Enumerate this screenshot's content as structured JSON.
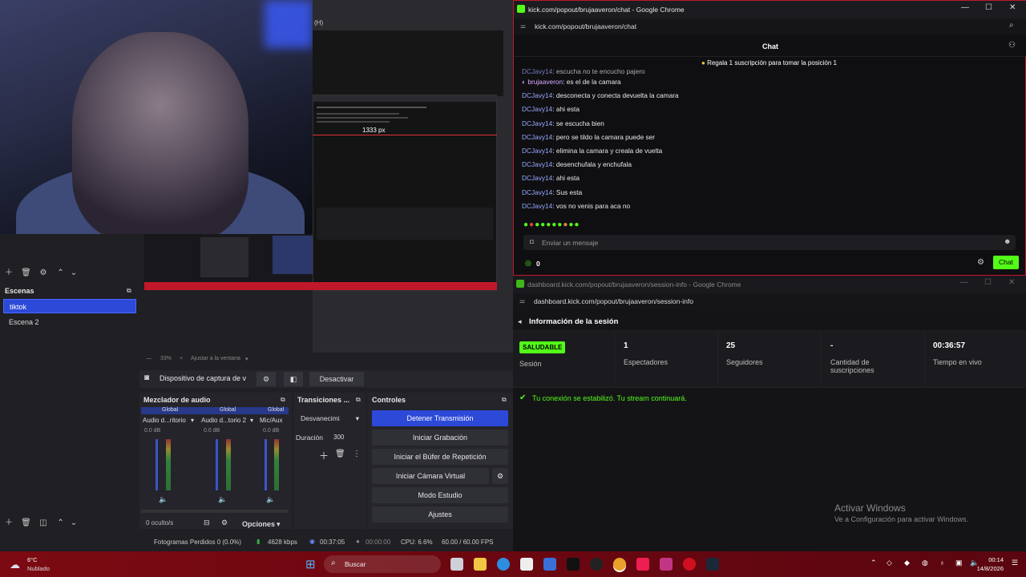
{
  "obs": {
    "preview_px_label": "1333 px",
    "preview_zoom": "33%",
    "preview_fit": "Ajustar a la ventana",
    "source_label": "Dispositivo de captura de v",
    "deactivate_label": "Desactivar",
    "scenes_title": "Escenas",
    "scenes": [
      "tiktok",
      "Escena 2"
    ],
    "mixer_title": "Mezclador de audio",
    "mixer_channels": [
      {
        "group": "Global",
        "name": "Audio d...ritorio",
        "db": "0.0 dB"
      },
      {
        "group": "Global",
        "name": "Audio d...torio 2",
        "db": "0.0 dB"
      },
      {
        "group": "Global",
        "name": "Mic/Aux",
        "db": "0.0 dB"
      }
    ],
    "mixer_hidden": "0 oculto/s",
    "transitions_title": "Transiciones ...",
    "transition_type": "Desvanecimi",
    "duration_label": "Duración",
    "duration_value": "300",
    "controls_title": "Controles",
    "controls": {
      "stop_stream": "Detener Transmisión",
      "start_rec": "Iniciar Grabación",
      "replay_buffer": "Iniciar el Búfer de Repetición",
      "virtual_cam": "Iniciar Cámara Virtual",
      "studio_mode": "Modo Estudio",
      "settings": "Ajustes"
    },
    "options_label": "Opciones",
    "status": {
      "dropped": "Fotogramas Perdidos 0 (0.0%)",
      "kbps": "4628 kbps",
      "live_time": "00:37:05",
      "rec_time": "00:00:00",
      "cpu": "CPU: 6.6%",
      "fps": "60.00 / 60.00 FPS"
    },
    "top_label": "(H)"
  },
  "chat_window": {
    "title": "kick.com/popout/brujaaveron/chat - Google Chrome",
    "url": "kick.com/popout/brujaaveron/chat",
    "header": "Chat",
    "pinned": "Regala 1 suscripción para tomar la posición 1",
    "messages": [
      {
        "user": "DCJavy14",
        "text": "escucha no te encucho pajero",
        "partial": true
      },
      {
        "user": "brujaaveron",
        "text": "es el de la camara",
        "host": true
      },
      {
        "user": "DCJavy14",
        "text": "desconecta y conecta devuelta la camara"
      },
      {
        "user": "DCJavy14",
        "text": "ahi esta"
      },
      {
        "user": "DCJavy14",
        "text": "se escucha bien"
      },
      {
        "user": "DCJavy14",
        "text": "pero se tildo la camara puede ser"
      },
      {
        "user": "DCJavy14",
        "text": "elimina la camara y creala de vuelta"
      },
      {
        "user": "DCJavy14",
        "text": "desenchufala y enchufala"
      },
      {
        "user": "DCJavy14",
        "text": "ahi esta"
      },
      {
        "user": "DCJavy14",
        "text": "Sus esta"
      },
      {
        "user": "DCJavy14",
        "text": "vos no venis para aca no"
      }
    ],
    "input_placeholder": "Enviar un mensaje",
    "points": "0",
    "chat_button": "Chat"
  },
  "dash_window": {
    "title": "dashboard.kick.com/popout/brujaaveron/session-info - Google Chrome",
    "url": "dashboard.kick.com/popout/brujaaveron/session-info",
    "section_title": "Información de la sesión",
    "health_badge": "SALUDABLE",
    "health_label": "Sesión",
    "viewers_value": "1",
    "viewers_label": "Espectadores",
    "followers_value": "25",
    "followers_label": "Seguidores",
    "subs_value": "-",
    "subs_label": "Cantidad de suscripciones",
    "uptime_value": "00:36:57",
    "uptime_label": "Tiempo en vivo",
    "connection_msg": "Tu conexión se estabilizó. Tu stream continuará.",
    "activate_title": "Activar Windows",
    "activate_sub": "Ve a Configuración para activar Windows."
  },
  "taskbar": {
    "weather_temp": "6°C",
    "weather_desc": "Nublado",
    "search": "Buscar",
    "time": "00:14",
    "date": "14/8/2026"
  },
  "colors": {
    "accent_blue": "#2c49d8",
    "kick_green": "#53fc18",
    "red": "#c0182a"
  }
}
